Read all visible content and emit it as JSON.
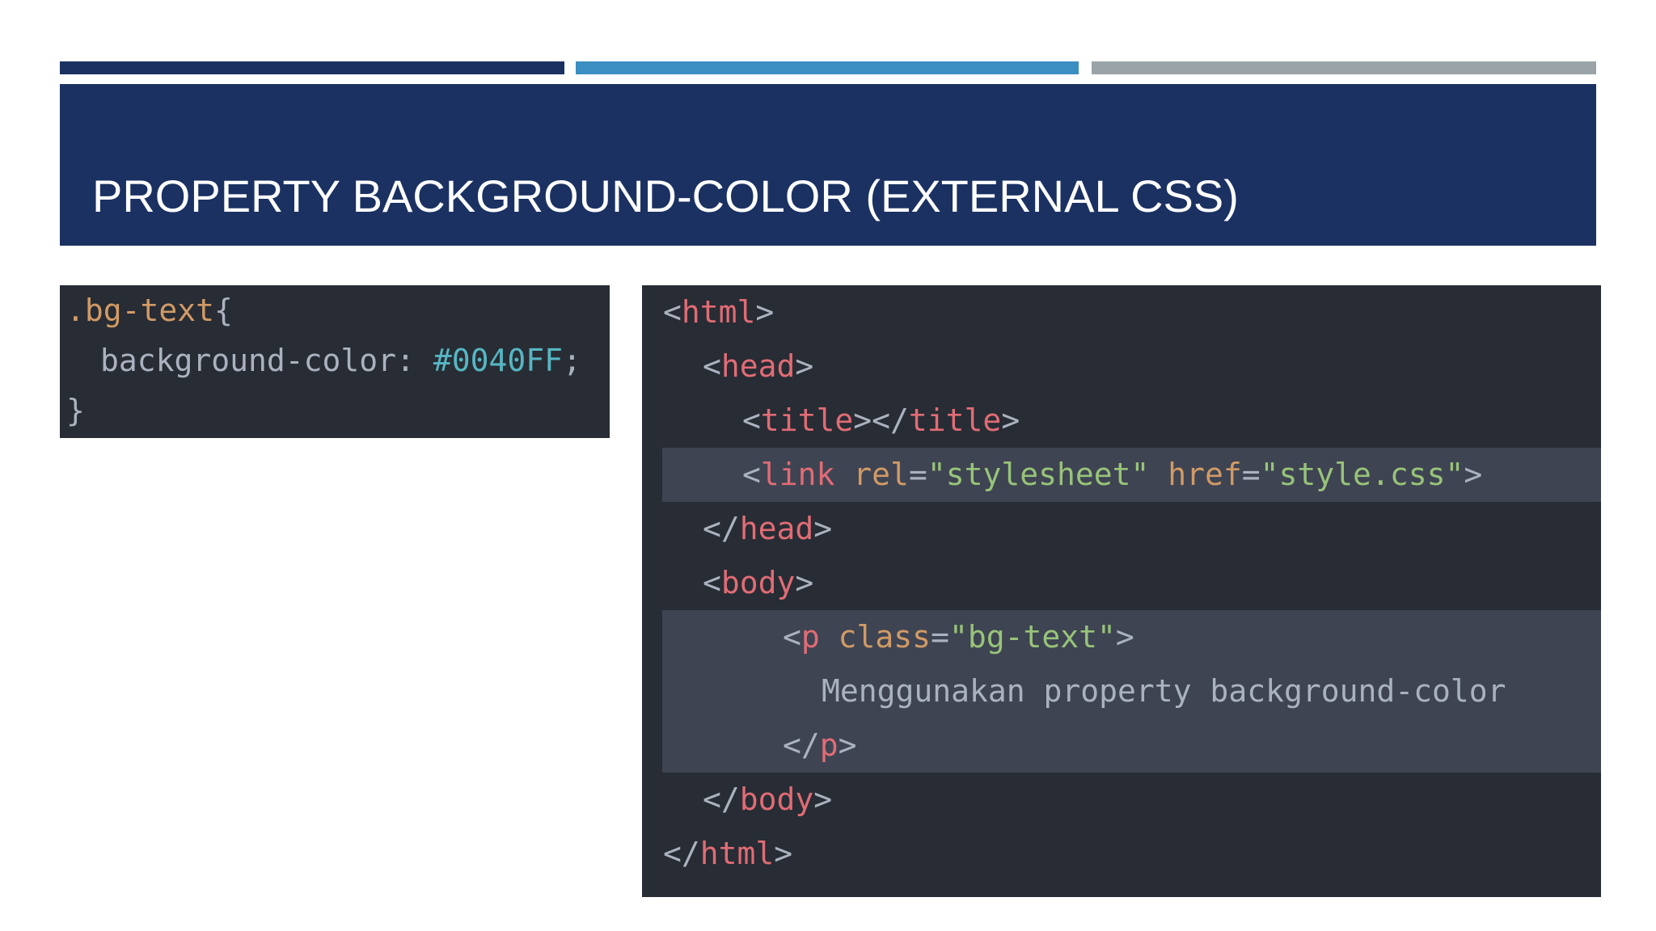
{
  "slide": {
    "title": "PROPERTY BACKGROUND-COLOR (EXTERNAL CSS)"
  },
  "css_code": {
    "selector": ".bg-text",
    "open_brace": "{",
    "property": "background-color",
    "colon": ":",
    "value": "#0040FF",
    "semicolon": ";",
    "close_brace": "}"
  },
  "html_code": {
    "html_open": "html",
    "head_open": "head",
    "title_tag": "title",
    "link_tag": "link",
    "rel_attr": "rel",
    "rel_value": "\"stylesheet\"",
    "href_attr": "href",
    "href_value": "\"style.css\"",
    "head_close": "head",
    "body_open": "body",
    "p_tag": "p",
    "class_attr": "class",
    "class_value": "\"bg-text\"",
    "p_text": "Menggunakan property background-color",
    "p_close": "p",
    "body_close": "body",
    "html_close": "html"
  },
  "colors": {
    "title_band": "#1b3162",
    "bar_1": "#1b3162",
    "bar_2": "#3a8ec2",
    "bar_3": "#9aa3a8",
    "code_bg": "#282c34",
    "highlight": "#3e4452"
  }
}
